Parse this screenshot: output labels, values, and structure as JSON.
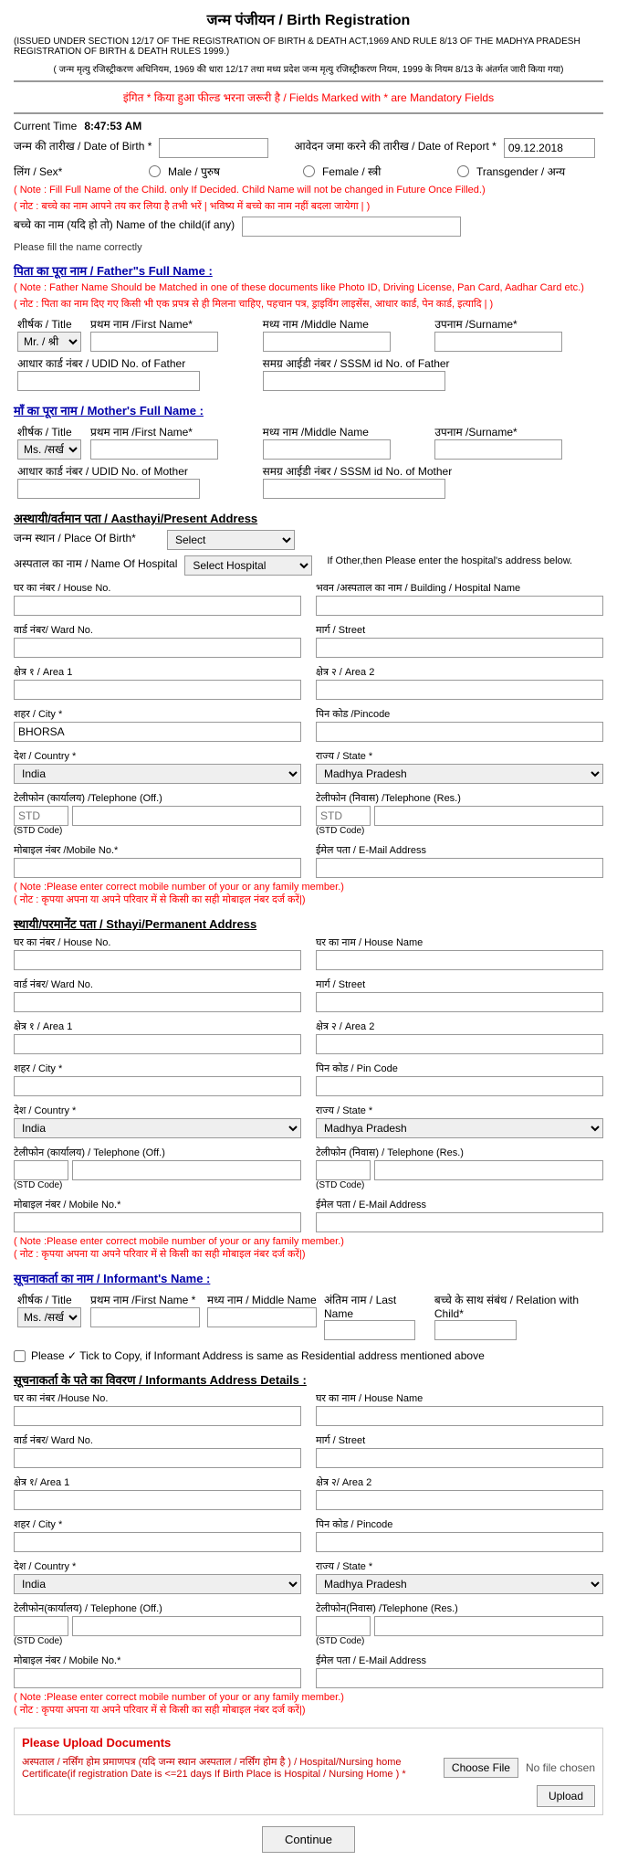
{
  "page": {
    "title": "जन्म पंजीयन / Birth Registration",
    "issued_under": "(ISSUED UNDER SECTION 12/17 OF THE REGISTRATION OF BIRTH & DEATH ACT,1969 AND RULE 8/13 OF THE MADHYA PRADESH REGISTRATION OF BIRTH & DEATH RULES 1999.)",
    "issued_hindi": "( जन्म मृत्यु रजिस्ट्रीकरण अधिनियम, 1969 की धारा 12/17 तथा मध्य प्रदेश जन्म मृत्यु रजिस्ट्रीकरण नियम, 1999 के नियम 8/13 के अंतर्गत जारी किया गया)",
    "mandatory_note": "इंगित * किया हुआ फील्ड भरना जरूरी है / Fields Marked with * are Mandatory Fields",
    "current_time_label": "Current Time",
    "current_time": "8:47:53 AM",
    "dob_label": "जन्म की तारीख / Date of Birth *",
    "report_date_label": "आवेदन जमा करने की तारीख / Date of Report *",
    "report_date_value": "09.12.2018",
    "sex_label": "लिंग / Sex*",
    "sex_options": [
      "Male / पुरुष",
      "Female / स्त्री",
      "Transgender / अन्य"
    ],
    "child_note1": "( Note : Fill Full Name of the Child. only If Decided. Child Name will not be changed in Future Once Filled.)",
    "child_note2": "( नोट : बच्चे का नाम आपने तय कर लिया है तभी भरें | भविष्य में बच्चे का नाम नहीं बदला जायेगा | )",
    "child_name_label": "बच्चे का नाम (यदि हो तो) Name of the child(if any)",
    "child_name_note": "Please fill the name correctly",
    "father_section_title": "पिता का पूरा नाम / Father\"s Full Name :",
    "father_note1": "( Note : Father Name Should be Matched in one of these documents like Photo ID, Driving License, Pan Card, Aadhar Card etc.)",
    "father_note2": "( नोट : पिता का नाम दिए गए किसी भी एक प्रपत्र से ही मिलना चाहिए, पहचान पत्र, ड्राइविंग लाइसेंस, आधार कार्ड, पेन कार्ड, इत्यादि | )",
    "father_title_options": [
      "Mr. / श्री"
    ],
    "father_title_default": "Mr. / श्री",
    "salutation_label": "शीर्षक / Title",
    "first_name_label": "प्रथम नाम /First Name*",
    "middle_name_label": "मध्य नाम /Middle Name",
    "surname_label": "उपनाम /Surname*",
    "aadhar_father_label": "आधार कार्ड नंबर / UDID No. of Father",
    "sssm_father_label": "समग्र आईडी नंबर / SSSM id No. of Father",
    "mother_section_title": "माँ का पूरा नाम / Mother's Full Name :",
    "mother_title_options": [
      "Ms. /सखी"
    ],
    "mother_title_default": "Ms. /सखी",
    "aadhar_mother_label": "आधार कार्ड नंबर / UDID No. of Mother",
    "sssm_mother_label": "समग्र आईडी नंबर / SSSM id No. of Mother",
    "present_address_title": "अस्थायी/वर्तमान पता / Aasthayi/Present Address",
    "place_of_birth_label": "जन्म स्थान / Place Of Birth*",
    "place_of_birth_options": [
      "Select"
    ],
    "place_of_birth_default": "Select",
    "hospital_name_label": "अस्पताल का नाम / Name Of Hospital",
    "hospital_select_default": "Select Hospital",
    "hospital_other_text": "If Other,then Please enter the hospital's address below.",
    "house_no_label": "घर का नंबर / House No.",
    "building_label": "भवन /अस्पताल का नाम / Building / Hospital Name",
    "ward_no_label": "वार्ड नंबर/ Ward No.",
    "street_label": "मार्ग / Street",
    "area1_label": "क्षेत्र १ / Area 1",
    "area2_label": "क्षेत्र २ / Area 2",
    "city_label": "शहर / City *",
    "city_value": "BHORSA",
    "pincode_label": "पिन कोड /Pincode",
    "country_label": "देश / Country *",
    "country_default": "India",
    "state_label": "राज्य / State *",
    "state_default": "Madhya Pradesh",
    "telephone_off_label": "टेलीफोन (कार्यालय) /Telephone (Off.)",
    "std_code_label": "(STD Code)",
    "telephone_res_label": "टेलीफोन (निवास) /Telephone (Res.)",
    "mobile_label": "मोबाइल नंबर /Mobile No.*",
    "email_label": "ईमेल पता / E-Mail Address",
    "mobile_note1": "( Note :Please enter correct mobile number of your or any family member.)",
    "mobile_note2": "( नोट : कृपया अपना या अपने परिवार में से किसी का सही मोबाइल नंबर दर्ज करें|)",
    "permanent_address_title": "स्थायी/परमानेंट पता / Sthayi/Permanent Address",
    "perm_house_no_label": "घर का नंबर / House No.",
    "perm_house_name_label": "घर का नाम / House Name",
    "perm_ward_label": "वार्ड नंबर/ Ward No.",
    "perm_street_label": "मार्ग / Street",
    "perm_area1_label": "क्षेत्र १ / Area 1",
    "perm_area2_label": "क्षेत्र २ / Area 2",
    "perm_city_label": "शहर / City *",
    "perm_pincode_label": "पिन कोड / Pin Code",
    "perm_country_label": "देश / Country *",
    "perm_country_default": "India",
    "perm_state_label": "राज्य / State *",
    "perm_telephone_off_label": "टेलीफोन (कार्यालय) / Telephone (Off.)",
    "perm_telephone_res_label": "टेलीफोन (निवास) / Telephone (Res.)",
    "perm_mobile_label": "मोबाइल नंबर / Mobile No.*",
    "perm_email_label": "ईमेल पता / E-Mail Address",
    "perm_mobile_note1": "( Note :Please enter correct mobile number of your or any family member.)",
    "perm_mobile_note2": "( नोट : कृपया अपना या अपने परिवार में से किसी का सही मोबाइल नंबर दर्ज करें|)",
    "informant_title": "सूचनाकर्ता का नाम / Informant's Name :",
    "informant_title_default": "Ms. /सखी",
    "informant_first_name_label": "प्रथम नाम /First Name *",
    "informant_middle_name_label": "मध्य नाम / Middle Name",
    "informant_last_name_label": "अंतिम नाम / Last Name",
    "informant_relation_label": "बच्चे के साथ संबंध / Relation with Child*",
    "tick_copy_label": "Please ✓ Tick to Copy, if Informant Address is same as Residential address mentioned above",
    "informant_address_title": "सूचनाकर्ता के पते का विवरण / Informants Address Details :",
    "inf_house_no_label": "घर का नंबर /House No.",
    "inf_house_name_label": "घर का नाम / House Name",
    "inf_ward_label": "वार्ड नंबर/ Ward No.",
    "inf_street_label": "मार्ग / Street",
    "inf_area1_label": "क्षेत्र १/ Area 1",
    "inf_area2_label": "क्षेत्र २/ Area 2",
    "inf_city_label": "शहर / City *",
    "inf_pincode_label": "पिन कोड / Pincode",
    "inf_country_label": "देश / Country *",
    "inf_country_default": "India",
    "inf_state_label": "राज्य / State *",
    "inf_state_default": "Madhya Pradesh",
    "inf_telephone_off_label": "टेलीफोन(कार्यालय) / Telephone (Off.)",
    "inf_telephone_res_label": "टेलीफोन(निवास) /Telephone (Res.)",
    "inf_mobile_label": "मोबाइल नंबर / Mobile No.*",
    "inf_email_label": "ईमेल पता / E-Mail Address",
    "inf_mobile_note1": "( Note :Please enter correct mobile number of your or any family member.)",
    "inf_mobile_note2": "( नोट : कृपया अपना या अपने परिवार में से किसी का सही मोबाइल नंबर दर्ज करें|)",
    "upload_section_title": "Please Upload Documents",
    "upload_doc_label": "अस्पताल / नर्सिंग होम प्रमाणपत्र (यदि जन्म स्थान अस्पताल / नर्सिंग होम है ) / Hospital/Nursing home Certificate(if registration Date is <=21 days If Birth Place is Hospital / Nursing Home ) *",
    "choose_btn_label": "Choose File",
    "no_file_text": "No file chosen",
    "upload_btn_label": "Upload",
    "continue_btn_label": "Continue"
  }
}
